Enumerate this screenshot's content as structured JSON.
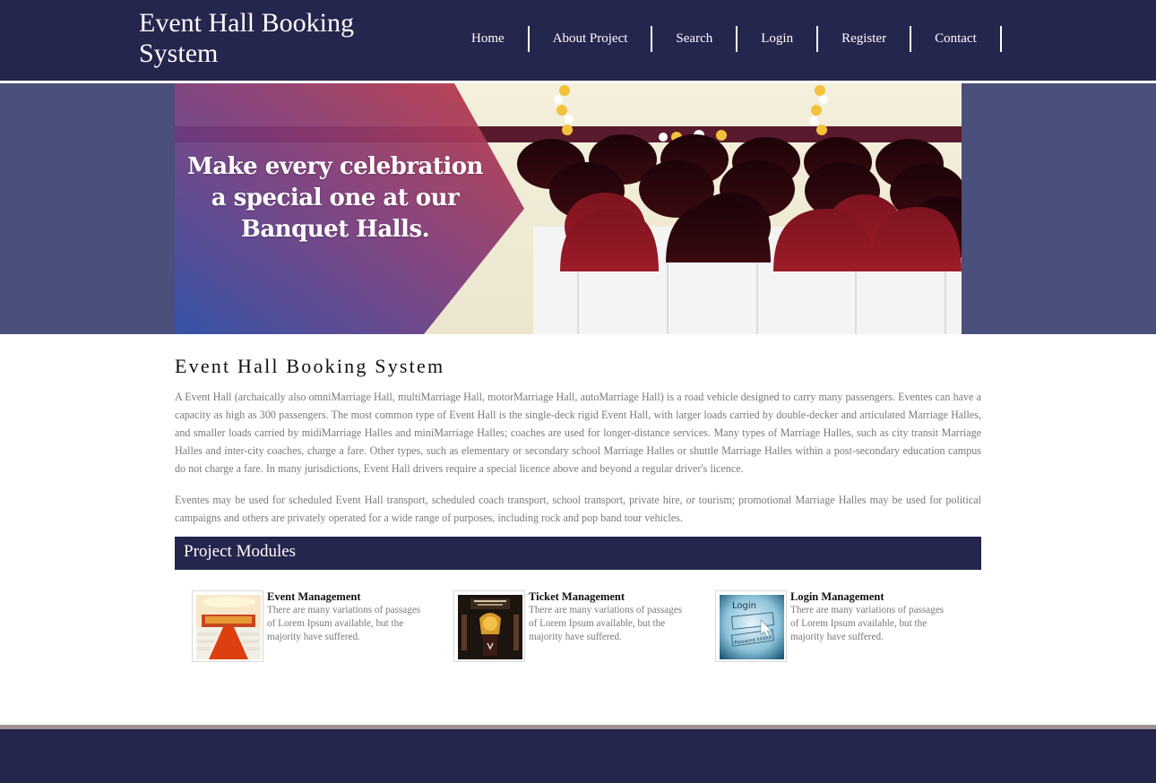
{
  "header": {
    "site_title": "Event Hall Booking System",
    "nav": [
      {
        "label": "Home"
      },
      {
        "label": "About Project"
      },
      {
        "label": "Search"
      },
      {
        "label": "Login"
      },
      {
        "label": "Register"
      },
      {
        "label": "Contact"
      }
    ]
  },
  "banner": {
    "lines": [
      "Make every celebration",
      "a special one at our",
      "Banquet Halls."
    ],
    "image": "banquet-hall-chairs-photo"
  },
  "main": {
    "heading": "Event Hall Booking System",
    "paragraphs": [
      "A Event Hall (archaically also omniMarriage Hall, multiMarriage Hall, motorMarriage Hall, autoMarriage Hall) is a road vehicle designed to carry many passengers. Eventes can have a capacity as high as 300 passengers. The most common type of Event Hall is the single-deck rigid Event Hall, with larger loads carried by double-decker and articulated Marriage Halles, and smaller loads carried by midiMarriage Halles and miniMarriage Halles; coaches are used for longer-distance services. Many types of Marriage Halles, such as city transit Marriage Halles and inter-city coaches, charge a fare. Other types, such as elementary or secondary school Marriage Halles or shuttle Marriage Halles within a post-secondary education campus do not charge a fare. In many jurisdictions, Event Hall drivers require a special licence above and beyond a regular driver's licence.",
      "Eventes may be used for scheduled Event Hall transport, scheduled coach transport, school transport, private hire, or tourism; promotional Marriage Halles may be used for political campaigns and others are privately operated for a wide range of purposes, including rock and pop band tour vehicles."
    ]
  },
  "modules": {
    "title": "Project Modules",
    "items": [
      {
        "name": "Event Management",
        "description": "There are many variations of passages of Lorem Ipsum available, but the majority have suffered.",
        "image": "event-hall-aisle-photo"
      },
      {
        "name": "Ticket Management",
        "description": "There are many variations of passages of Lorem Ipsum available, but the majority have suffered.",
        "image": "ticket-venue-photo"
      },
      {
        "name": "Login Management",
        "description": "There are many variations of passages of Lorem Ipsum available, but the majority have suffered.",
        "image": "login-form-photo"
      }
    ]
  },
  "colors": {
    "header_bg": "#25264d",
    "banner_band": "#4b4f7c",
    "footer_rule": "#a09291",
    "body_text": "#7a7a7a"
  }
}
